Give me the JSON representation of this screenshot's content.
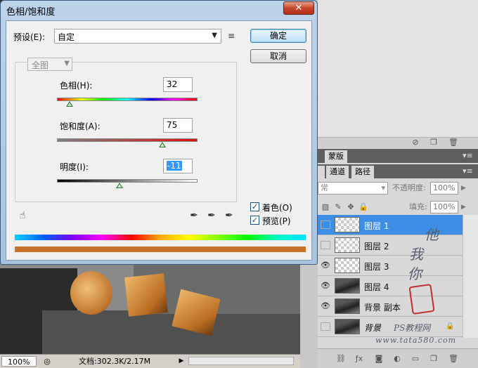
{
  "dialog": {
    "title": "色相/饱和度",
    "close": "✕",
    "preset_label": "预设(E):",
    "preset_value": "自定",
    "ok": "确定",
    "cancel": "取消",
    "edit_scope": "全图",
    "hue_label": "色相(H):",
    "hue_value": "32",
    "saturation_label": "饱和度(A):",
    "saturation_value": "75",
    "lightness_label": "明度(I):",
    "lightness_value": "-11",
    "colorize_label": "着色(O)",
    "colorize_checked": true,
    "preview_label": "预览(P)",
    "preview_checked": true,
    "hue_fraction": 0.09,
    "saturation_fraction": 0.75,
    "lightness_fraction": 0.445
  },
  "panels": {
    "tabs_top": [
      "",
      "蒙版"
    ],
    "tabs_layers": [
      "",
      "通道",
      "路径"
    ],
    "blend_mode": "常",
    "opacity_label": "不透明度:",
    "opacity_value": "100%",
    "fill_label": "填充:",
    "fill_value": "100%"
  },
  "layers": [
    {
      "name": "图层 1",
      "visible": false,
      "selected": true
    },
    {
      "name": "图层 2",
      "visible": false,
      "selected": false
    },
    {
      "name": "图层 3",
      "visible": true,
      "selected": false
    },
    {
      "name": "图层 4",
      "visible": true,
      "selected": false
    },
    {
      "name": "背景 副本",
      "visible": true,
      "selected": false
    },
    {
      "name": "背景",
      "visible": false,
      "selected": false,
      "locked": true
    }
  ],
  "watermark": {
    "line1": "他",
    "line2": "我",
    "line3": "你",
    "site_cn": "PS教程网",
    "site_url": "www.tata580.com"
  },
  "status": {
    "zoom": "100%",
    "doc": "文档:302.3K/2.17M"
  },
  "colors": {
    "accent": "#3d8ee6",
    "dialog_frame": "#a9c3df",
    "result_bar": "#c87428"
  }
}
